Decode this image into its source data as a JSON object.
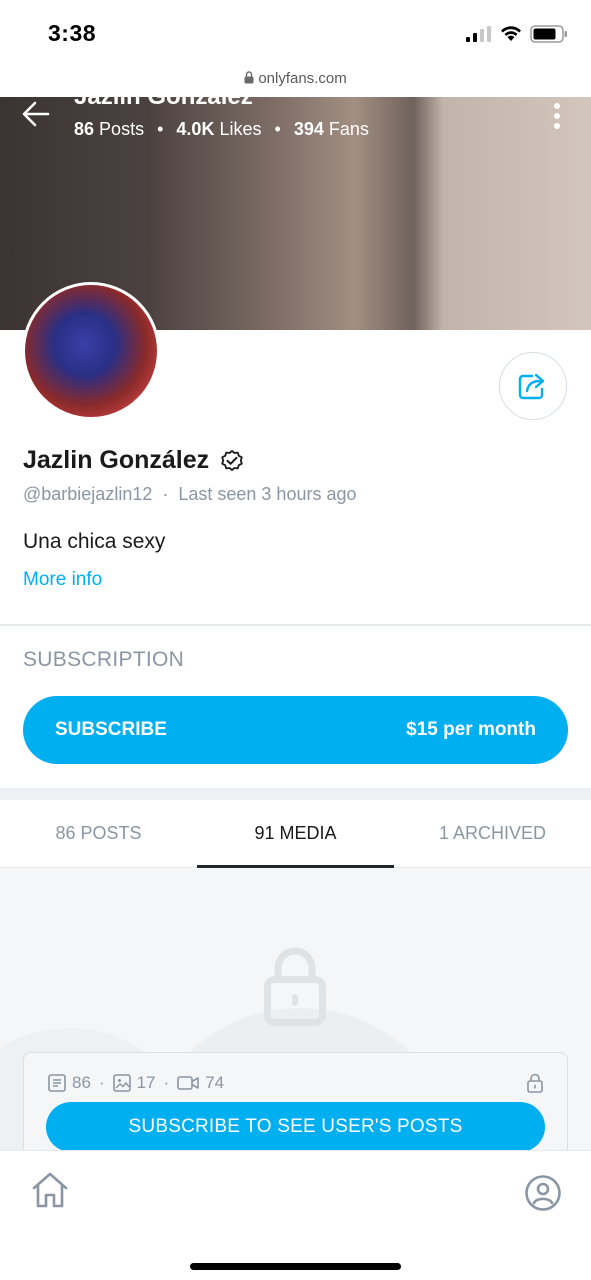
{
  "status_bar": {
    "time": "3:38"
  },
  "browser": {
    "url": "onlyfans.com"
  },
  "cover": {
    "name": "Jazlin González",
    "posts_count": "86",
    "posts_label": "Posts",
    "likes_count": "4.0K",
    "likes_label": "Likes",
    "fans_count": "394",
    "fans_label": "Fans"
  },
  "profile": {
    "name": "Jazlin González",
    "handle": "@barbiejazlin12",
    "last_seen": "Last seen 3 hours ago",
    "bio": "Una chica sexy",
    "more_info": "More info"
  },
  "subscription": {
    "heading": "SUBSCRIPTION",
    "button_label": "SUBSCRIBE",
    "price": "$15 per month"
  },
  "tabs": [
    {
      "label": "86 POSTS",
      "active": false
    },
    {
      "label": "91 MEDIA",
      "active": true
    },
    {
      "label": "1 ARCHIVED",
      "active": false
    }
  ],
  "locked_card": {
    "text_posts": "86",
    "photos": "17",
    "videos": "74",
    "button_label": "SUBSCRIBE TO SEE USER'S POSTS"
  },
  "colors": {
    "accent": "#00aff0",
    "muted": "#8a96a3"
  }
}
